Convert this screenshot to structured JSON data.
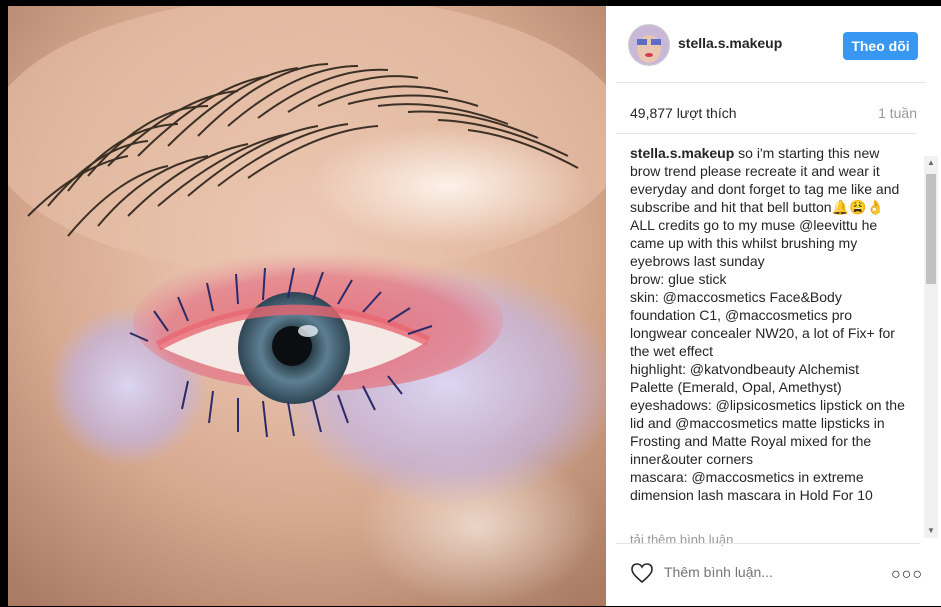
{
  "post": {
    "username": "stella.s.makeup",
    "follow_label": "Theo dõi",
    "likes_text": "49,877 lượt thích",
    "time_ago": "1 tuần",
    "caption_user": "stella.s.makeup",
    "caption_text": " so i'm starting this new brow trend please recreate it and wear it everyday and dont forget to tag me like and subscribe and hit that bell button🔔😩👌\nALL credits go to my muse @leevittu he came up with this whilst brushing my eyebrows last sunday\nbrow: glue stick\nskin: @maccosmetics Face&Body foundation C1, @maccosmetics pro longwear concealer NW20, a lot of Fix+ for the wet effect\nhighlight: @katvondbeauty Alchemist Palette (Emerald, Opal, Amethyst)\neyeshadows: @lipsicosmetics lipstick on the lid and @maccosmetics matte lipsticks in Frosting and Matte Royal mixed for the inner&outer corners\nmascara: @maccosmetics in extreme dimension lash mascara in Hold For 10",
    "load_more": "tải thêm bình luận",
    "comment_placeholder": "Thêm bình luận...",
    "more_options": "○○○"
  }
}
